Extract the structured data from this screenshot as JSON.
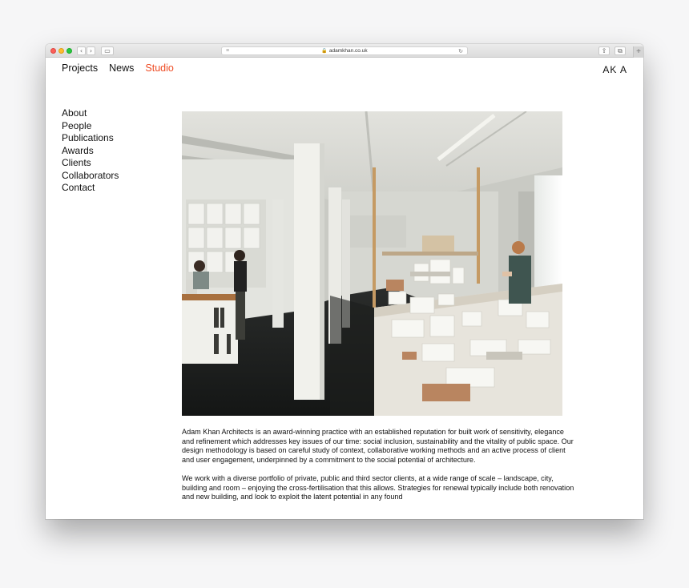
{
  "browser": {
    "url": "adamkhan.co.uk",
    "lock_icon": "lock-icon",
    "reader_icon": "reader-icon",
    "reload_icon": "reload-icon",
    "back_icon": "chevron-left-icon",
    "forward_icon": "chevron-right-icon",
    "sidebar_icon": "sidebar-icon",
    "share_icon": "share-icon",
    "tabs_icon": "tabs-icon",
    "new_tab_label": "+"
  },
  "header": {
    "nav": [
      {
        "label": "Projects",
        "active": false
      },
      {
        "label": "News",
        "active": false
      },
      {
        "label": "Studio",
        "active": true
      }
    ],
    "logo": "AK A",
    "accent_color": "#ee4b23"
  },
  "sidebar": {
    "items": [
      {
        "label": "About"
      },
      {
        "label": "People"
      },
      {
        "label": "Publications"
      },
      {
        "label": "Awards"
      },
      {
        "label": "Clients"
      },
      {
        "label": "Collaborators"
      },
      {
        "label": "Contact"
      }
    ]
  },
  "content": {
    "paragraphs": [
      "Adam Khan Architects is an award-winning practice with an established reputation for built work of sensitivity, elegance and refinement which addresses key issues of our time: social inclusion, sustainability and the vitality of public space. Our design methodology is based on careful study of context, collaborative working methods and an active process of client and user engagement, underpinned by a commitment to the social potential of architecture.",
      "We work with a diverse portfolio of private, public and third sector clients, at a wide range of scale – landscape, city, building and room – enjoying the cross-fertilisation that this allows. Strategies for renewal typically include both renovation and new building, and look to exploit the latent potential in any found"
    ]
  }
}
